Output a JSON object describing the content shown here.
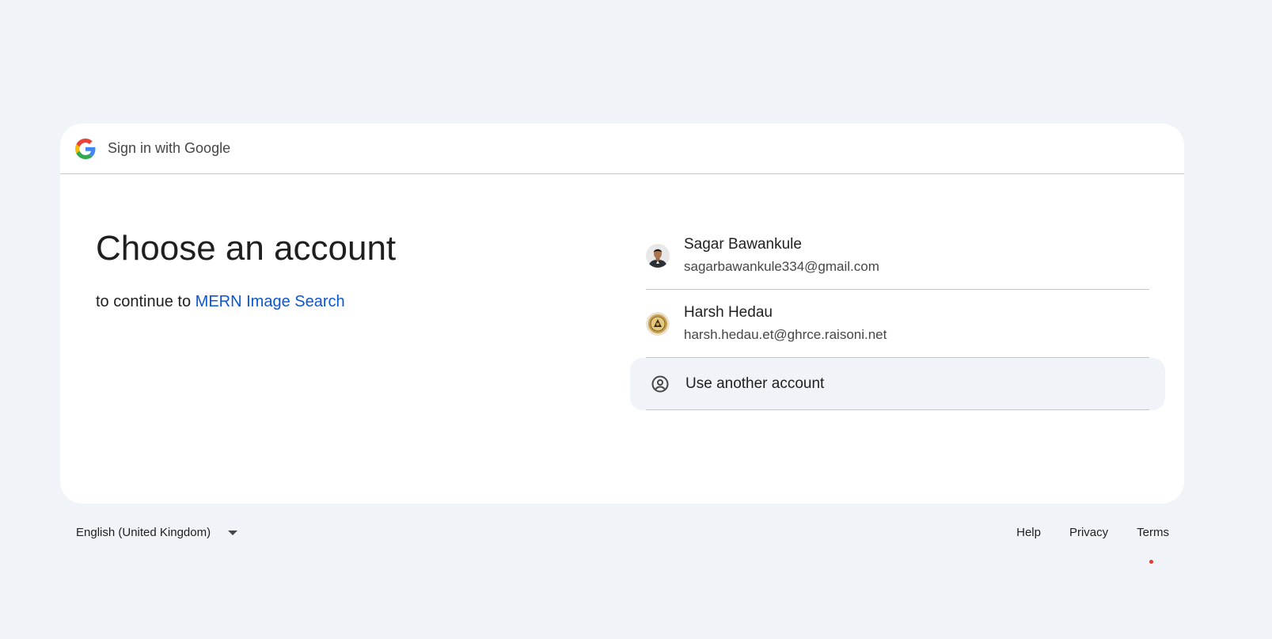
{
  "header": {
    "title": "Sign in with Google",
    "logo_icon": "google-g-logo"
  },
  "main": {
    "heading": "Choose an account",
    "continue_prefix": "to continue to ",
    "app_name": "MERN Image Search"
  },
  "accounts": [
    {
      "name": "Sagar Bawankule",
      "email": "sagarbawankule334@gmail.com",
      "avatar_icon": "user-photo-avatar"
    },
    {
      "name": "Harsh Hedau",
      "email": "harsh.hedau.et@ghrce.raisoni.net",
      "avatar_icon": "emblem-avatar"
    }
  ],
  "another_account": {
    "label": "Use another account",
    "icon": "account-circle-icon"
  },
  "footer": {
    "language": "English (United Kingdom)",
    "links": {
      "help": "Help",
      "privacy": "Privacy",
      "terms": "Terms"
    }
  },
  "colors": {
    "page_background": "#f0f4f9",
    "card_background": "#ffffff",
    "link_blue": "#0b57d0",
    "text_primary": "#1f1f1f",
    "text_secondary": "#444746"
  }
}
